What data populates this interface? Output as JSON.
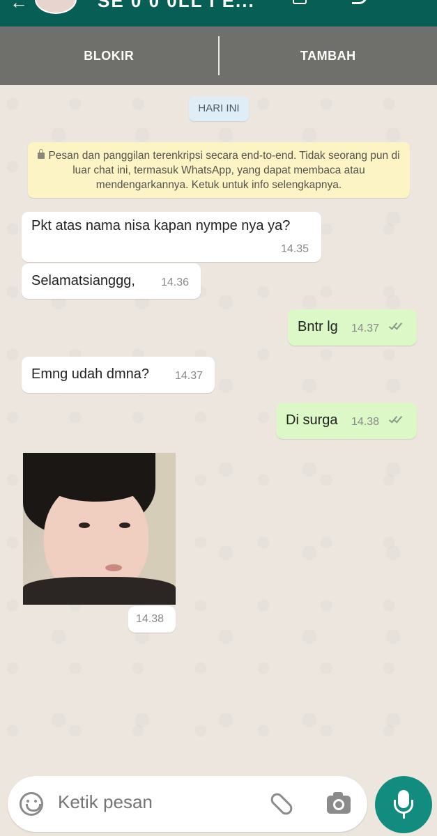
{
  "header": {
    "title": "SE 0 0 0LL I E...",
    "back_glyph": "←"
  },
  "actions": {
    "block_label": "BLOKIR",
    "add_label": "TAMBAH"
  },
  "chat": {
    "date_label": "HARI INI",
    "encryption_notice": "Pesan dan panggilan terenkripsi secara end-to-end. Tidak seorang pun di luar chat ini, termasuk WhatsApp, yang dapat membaca atau mendengarkannya. Ketuk untuk info selengkapnya.",
    "messages": [
      {
        "direction": "in",
        "text": "Pkt atas nama nisa kapan nympe nya ya?",
        "time": "14.35"
      },
      {
        "direction": "in",
        "text": "Selamatsianggg,",
        "time": "14.36"
      },
      {
        "direction": "out",
        "text": "Bntr lg",
        "time": "14.37",
        "status": "read"
      },
      {
        "direction": "in",
        "text": "Emng udah dmna?",
        "time": "14.37"
      },
      {
        "direction": "out",
        "text": "Di surga",
        "time": "14.38",
        "status": "read"
      },
      {
        "direction": "in",
        "type": "image",
        "time": "14.38"
      }
    ]
  },
  "composer": {
    "placeholder": "Ketik pesan"
  },
  "colors": {
    "header_green": "#075e54",
    "action_gray": "#6f6f6b",
    "outgoing_bubble": "#dcf8c6",
    "incoming_bubble": "#ffffff",
    "mic_button": "#128c7e",
    "notice_yellow": "#fdf4c5"
  }
}
